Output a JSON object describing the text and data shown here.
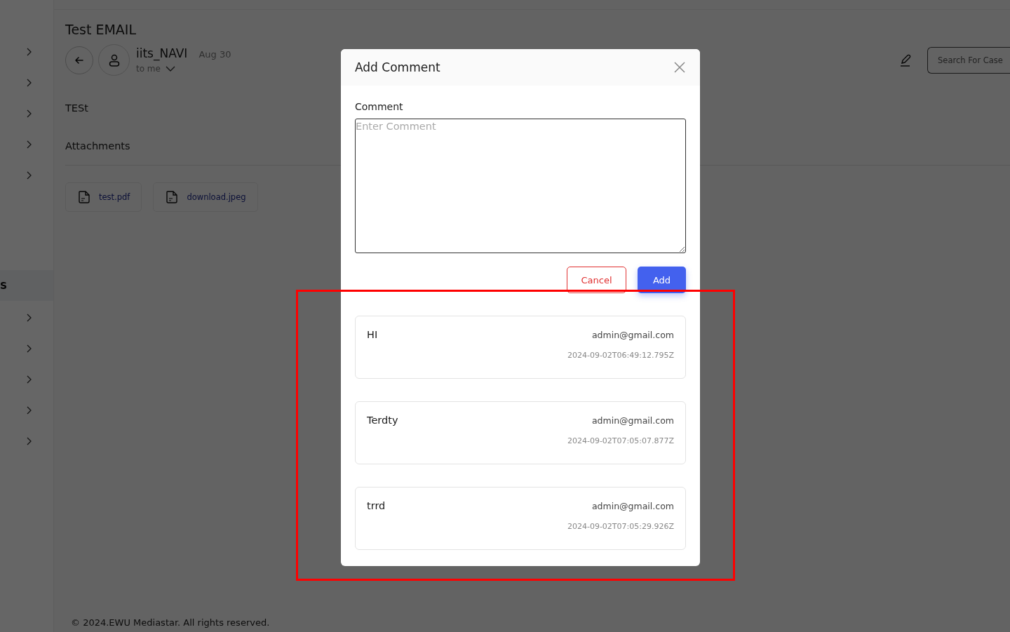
{
  "sidebar": {
    "items": [
      {
        "selected": false
      },
      {
        "selected": false
      },
      {
        "selected": false
      },
      {
        "selected": false
      },
      {
        "selected": false
      },
      {
        "label": "S",
        "selected": true
      },
      {
        "selected": false
      },
      {
        "selected": false
      },
      {
        "selected": false
      },
      {
        "selected": false
      },
      {
        "selected": false
      }
    ]
  },
  "email": {
    "title": "Test EMAIL",
    "sender": "iits_NAVI",
    "date": "Aug 30",
    "recipient": "to me",
    "body": "TESt",
    "attachments_heading": "Attachments",
    "attachments": [
      {
        "name": "test.pdf"
      },
      {
        "name": "download.jpeg"
      }
    ]
  },
  "search": {
    "placeholder": "Search For Case"
  },
  "footer": "© 2024.EWU Mediastar. All rights reserved.",
  "modal": {
    "title": "Add Comment",
    "field_label": "Comment",
    "placeholder": "Enter Comment",
    "buttons": [
      {
        "kind": "cancel",
        "label": "Cancel"
      },
      {
        "kind": "primary",
        "label": "Add"
      }
    ],
    "comments": [
      {
        "text": "HI",
        "author": "admin@gmail.com",
        "time": "2024-09-02T06:49:12.795Z"
      },
      {
        "text": "Terdty",
        "author": "admin@gmail.com",
        "time": "2024-09-02T07:05:07.877Z"
      },
      {
        "text": "trrd",
        "author": "admin@gmail.com",
        "time": "2024-09-02T07:05:29.926Z"
      }
    ]
  },
  "annotations": [
    {
      "kind": "box"
    }
  ]
}
